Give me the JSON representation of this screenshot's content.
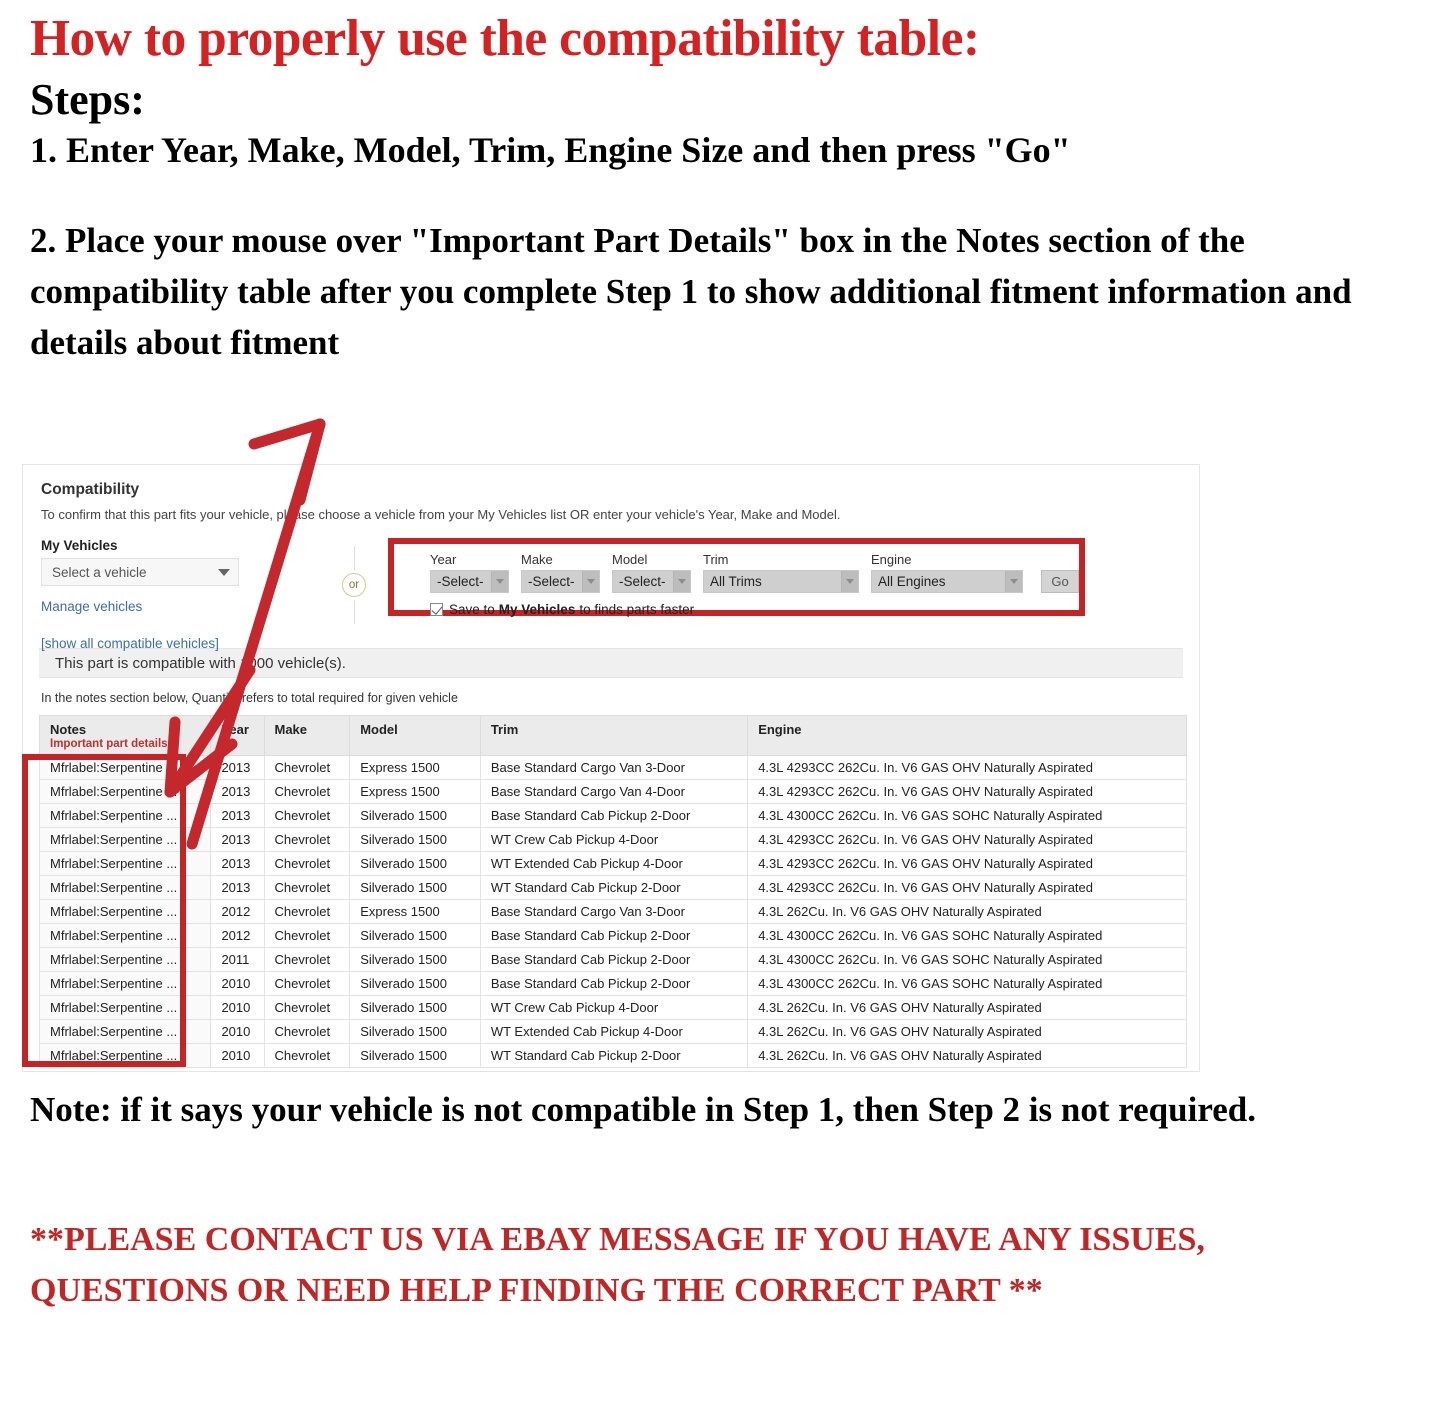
{
  "instructions": {
    "title": "How to properly use the compatibility table:",
    "steps_label": "Steps:",
    "step1": "1. Enter Year, Make, Model, Trim, Engine Size and then press \"Go\"",
    "step2": "2. Place your mouse over \"Important Part Details\" box in the Notes section of the compatibility table after you complete Step 1 to show additional fitment information and details about fitment",
    "note": "Note: if it says your vehicle is not compatible in Step 1, then Step 2 is not required.",
    "contact": "**PLEASE CONTACT US VIA EBAY MESSAGE IF YOU HAVE ANY ISSUES, QUESTIONS OR NEED HELP FINDING THE CORRECT PART **"
  },
  "colors": {
    "accent_red": "#d42222",
    "highlight_box": "#c42424",
    "link_blue": "#3d6ea5",
    "notes_sub_red": "#c03030",
    "arrow_red": "#c4282c"
  },
  "compatibility": {
    "heading": "Compatibility",
    "description": "To confirm that this part fits your vehicle, please choose a vehicle from your My Vehicles list OR enter your vehicle's Year, Make and Model.",
    "my_vehicles": {
      "label": "My Vehicles",
      "select_value": "Select a vehicle",
      "manage_link": "Manage vehicles",
      "show_all_link": "[show all compatible vehicles]"
    },
    "or_label": "or",
    "finder": {
      "fields": [
        {
          "label": "Year",
          "value": "-Select-"
        },
        {
          "label": "Make",
          "value": "-Select-"
        },
        {
          "label": "Model",
          "value": "-Select-"
        },
        {
          "label": "Trim",
          "value": "All Trims"
        },
        {
          "label": "Engine",
          "value": "All Engines"
        }
      ],
      "go_label": "Go",
      "save_checkbox": {
        "checked": true,
        "prefix": "Save to",
        "bold": "My Vehicles",
        "suffix": "to finds parts faster"
      }
    },
    "compat_count_text": "This part is compatible with 1000 vehicle(s).",
    "qty_note": "In the notes section below, Quantity refers to total required for given vehicle",
    "table": {
      "headers": {
        "notes": "Notes",
        "notes_sub": "Important part details",
        "year": "Year",
        "make": "Make",
        "model": "Model",
        "trim": "Trim",
        "engine": "Engine"
      },
      "rows": [
        {
          "notes": "Mfrlabel:Serpentine ...",
          "year": "2013",
          "make": "Chevrolet",
          "model": "Express 1500",
          "trim": "Base Standard Cargo Van 3-Door",
          "engine": "4.3L 4293CC 262Cu. In. V6 GAS OHV Naturally Aspirated"
        },
        {
          "notes": "Mfrlabel:Serpentine ...",
          "year": "2013",
          "make": "Chevrolet",
          "model": "Express 1500",
          "trim": "Base Standard Cargo Van 4-Door",
          "engine": "4.3L 4293CC 262Cu. In. V6 GAS OHV Naturally Aspirated"
        },
        {
          "notes": "Mfrlabel:Serpentine ...",
          "year": "2013",
          "make": "Chevrolet",
          "model": "Silverado 1500",
          "trim": "Base Standard Cab Pickup 2-Door",
          "engine": "4.3L 4300CC 262Cu. In. V6 GAS SOHC Naturally Aspirated"
        },
        {
          "notes": "Mfrlabel:Serpentine ...",
          "year": "2013",
          "make": "Chevrolet",
          "model": "Silverado 1500",
          "trim": "WT Crew Cab Pickup 4-Door",
          "engine": "4.3L 4293CC 262Cu. In. V6 GAS OHV Naturally Aspirated"
        },
        {
          "notes": "Mfrlabel:Serpentine ...",
          "year": "2013",
          "make": "Chevrolet",
          "model": "Silverado 1500",
          "trim": "WT Extended Cab Pickup 4-Door",
          "engine": "4.3L 4293CC 262Cu. In. V6 GAS OHV Naturally Aspirated"
        },
        {
          "notes": "Mfrlabel:Serpentine ...",
          "year": "2013",
          "make": "Chevrolet",
          "model": "Silverado 1500",
          "trim": "WT Standard Cab Pickup 2-Door",
          "engine": "4.3L 4293CC 262Cu. In. V6 GAS OHV Naturally Aspirated"
        },
        {
          "notes": "Mfrlabel:Serpentine ...",
          "year": "2012",
          "make": "Chevrolet",
          "model": "Express 1500",
          "trim": "Base Standard Cargo Van 3-Door",
          "engine": "4.3L 262Cu. In. V6 GAS OHV Naturally Aspirated"
        },
        {
          "notes": "Mfrlabel:Serpentine ...",
          "year": "2012",
          "make": "Chevrolet",
          "model": "Silverado 1500",
          "trim": "Base Standard Cab Pickup 2-Door",
          "engine": "4.3L 4300CC 262Cu. In. V6 GAS SOHC Naturally Aspirated"
        },
        {
          "notes": "Mfrlabel:Serpentine ...",
          "year": "2011",
          "make": "Chevrolet",
          "model": "Silverado 1500",
          "trim": "Base Standard Cab Pickup 2-Door",
          "engine": "4.3L 4300CC 262Cu. In. V6 GAS SOHC Naturally Aspirated"
        },
        {
          "notes": "Mfrlabel:Serpentine ...",
          "year": "2010",
          "make": "Chevrolet",
          "model": "Silverado 1500",
          "trim": "Base Standard Cab Pickup 2-Door",
          "engine": "4.3L 4300CC 262Cu. In. V6 GAS SOHC Naturally Aspirated"
        },
        {
          "notes": "Mfrlabel:Serpentine ...",
          "year": "2010",
          "make": "Chevrolet",
          "model": "Silverado 1500",
          "trim": "WT Crew Cab Pickup 4-Door",
          "engine": "4.3L 262Cu. In. V6 GAS OHV Naturally Aspirated"
        },
        {
          "notes": "Mfrlabel:Serpentine ...",
          "year": "2010",
          "make": "Chevrolet",
          "model": "Silverado 1500",
          "trim": "WT Extended Cab Pickup 4-Door",
          "engine": "4.3L 262Cu. In. V6 GAS OHV Naturally Aspirated"
        },
        {
          "notes": "Mfrlabel:Serpentine ...",
          "year": "2010",
          "make": "Chevrolet",
          "model": "Silverado 1500",
          "trim": "WT Standard Cab Pickup 2-Door",
          "engine": "4.3L 262Cu. In. V6 GAS OHV Naturally Aspirated"
        }
      ]
    }
  }
}
